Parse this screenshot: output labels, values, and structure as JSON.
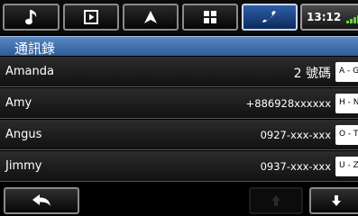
{
  "tabs": [
    {
      "icon": "music-note-icon",
      "active": false
    },
    {
      "icon": "video-play-icon",
      "active": false
    },
    {
      "icon": "navigation-arrow-icon",
      "active": false
    },
    {
      "icon": "grid-menu-icon",
      "active": false
    },
    {
      "icon": "phone-icon",
      "active": true
    }
  ],
  "status": {
    "time": "13:12",
    "signal_icon": "signal-strength-icon"
  },
  "header": {
    "title": "通訊錄"
  },
  "contacts": [
    {
      "name": "Amanda",
      "number": "2 號碼",
      "index": "A - G"
    },
    {
      "name": "Amy",
      "number": "+886928xxxxxx",
      "index": "H - N"
    },
    {
      "name": "Angus",
      "number": "0927-xxx-xxx",
      "index": "O - T"
    },
    {
      "name": "Jimmy",
      "number": "0937-xxx-xxx",
      "index": "U - Z"
    }
  ],
  "bottom": {
    "back_icon": "back-arrow-icon",
    "up_icon": "arrow-up-icon",
    "down_icon": "arrow-down-icon",
    "up_disabled": true
  },
  "colors": {
    "accent": "#2e5b99",
    "active_tab": "#2e5fa8",
    "signal": "#6bd13a"
  }
}
